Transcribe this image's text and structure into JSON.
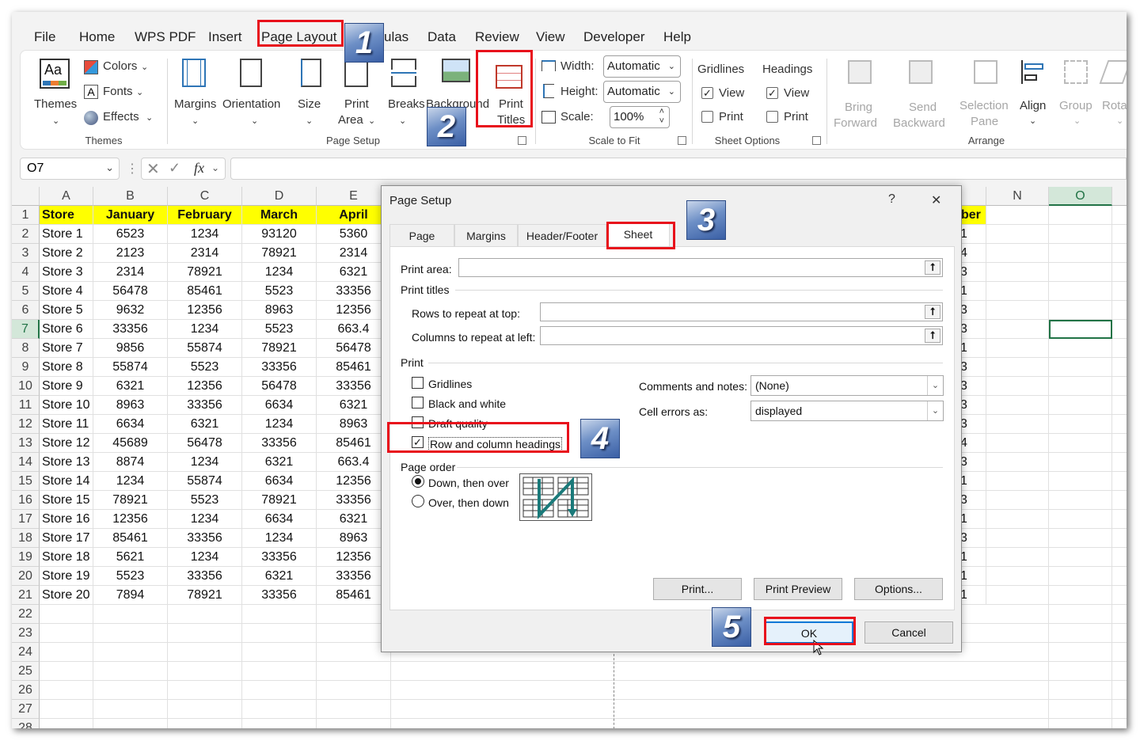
{
  "menu": [
    "File",
    "Home",
    "WPS PDF",
    "Insert",
    "Page Layout",
    "Formulas",
    "Data",
    "Review",
    "View",
    "Developer",
    "Help"
  ],
  "menu_visible": [
    "File",
    "Home",
    "WPS PDF",
    "Insert",
    "Page Layout",
    "ulas",
    "Data",
    "Review",
    "View",
    "Developer",
    "Help"
  ],
  "ribbon": {
    "themes": {
      "themes": "Themes",
      "colors": "Colors",
      "fonts": "Fonts",
      "effects": "Effects",
      "group": "Themes"
    },
    "page_setup": {
      "margins": "Margins",
      "orientation": "Orientation",
      "size": "Size",
      "print_area_1": "Print",
      "print_area_2": "Area",
      "breaks": "Breaks",
      "background": "Background",
      "print_titles_1": "Print",
      "print_titles_2": "Titles",
      "group": "Page Setup"
    },
    "scale": {
      "width_label": "Width:",
      "width_value": "Automatic",
      "height_label": "Height:",
      "height_value": "Automatic",
      "scale_label": "Scale:",
      "scale_value": "100%",
      "group": "Scale to Fit"
    },
    "sheet_options": {
      "gridlines": "Gridlines",
      "headings": "Headings",
      "view": "View",
      "print": "Print",
      "group": "Sheet Options"
    },
    "arrange": {
      "bring_1": "Bring",
      "bring_2": "Forward",
      "send_1": "Send",
      "send_2": "Backward",
      "selection_1": "Selection",
      "selection_2": "Pane",
      "align": "Align",
      "group_btn": "Group",
      "rotate": "Rota",
      "group": "Arrange"
    }
  },
  "formula_bar": {
    "name_box": "O7",
    "fx": "fx"
  },
  "columns": [
    "A",
    "B",
    "C",
    "D",
    "E",
    "N",
    "O"
  ],
  "rows": [
    1,
    2,
    3,
    4,
    5,
    6,
    7,
    8,
    9,
    10,
    11,
    12,
    13,
    14,
    15,
    16,
    17,
    18,
    19,
    20,
    21,
    22,
    23,
    24,
    25,
    26,
    27,
    28
  ],
  "table": {
    "headers": [
      "Store",
      "January",
      "February",
      "March",
      "April"
    ],
    "data": [
      [
        "Store 1",
        "6523",
        "1234",
        "93120",
        "5360"
      ],
      [
        "Store 2",
        "2123",
        "2314",
        "78921",
        "2314"
      ],
      [
        "Store 3",
        "2314",
        "78921",
        "1234",
        "6321"
      ],
      [
        "Store 4",
        "56478",
        "85461",
        "5523",
        "33356"
      ],
      [
        "Store 5",
        "9632",
        "12356",
        "8963",
        "12356"
      ],
      [
        "Store 6",
        "33356",
        "1234",
        "5523",
        "663.4"
      ],
      [
        "Store 7",
        "9856",
        "55874",
        "78921",
        "56478"
      ],
      [
        "Store 8",
        "55874",
        "5523",
        "33356",
        "85461"
      ],
      [
        "Store 9",
        "6321",
        "12356",
        "56478",
        "33356"
      ],
      [
        "Store 10",
        "8963",
        "33356",
        "6634",
        "6321"
      ],
      [
        "Store 11",
        "6634",
        "6321",
        "1234",
        "8963"
      ],
      [
        "Store 12",
        "45689",
        "56478",
        "33356",
        "85461"
      ],
      [
        "Store 13",
        "8874",
        "1234",
        "6321",
        "663.4"
      ],
      [
        "Store 14",
        "1234",
        "55874",
        "6634",
        "12356"
      ],
      [
        "Store 15",
        "78921",
        "5523",
        "78921",
        "33356"
      ],
      [
        "Store 16",
        "12356",
        "1234",
        "6634",
        "6321"
      ],
      [
        "Store 17",
        "85461",
        "33356",
        "1234",
        "8963"
      ],
      [
        "Store 18",
        "5621",
        "1234",
        "33356",
        "12356"
      ],
      [
        "Store 19",
        "5523",
        "33356",
        "6321",
        "33356"
      ],
      [
        "Store 20",
        "7894",
        "78921",
        "33356",
        "85461"
      ]
    ],
    "partial_header": "ber",
    "partial_col": [
      "1",
      "4",
      "3",
      "1",
      "3",
      "3",
      "1",
      "3",
      "3",
      "3",
      "3",
      "4",
      "3",
      "1",
      "3",
      "1",
      "3",
      "1",
      "1",
      "1"
    ]
  },
  "dialog": {
    "title": "Page Setup",
    "help": "?",
    "close": "✕",
    "tabs": [
      "Page",
      "Margins",
      "Header/Footer",
      "Sheet"
    ],
    "print_area": "Print area:",
    "print_titles": "Print titles",
    "rows_repeat": "Rows to repeat at top:",
    "cols_repeat": "Columns to repeat at left:",
    "print_section": "Print",
    "gridlines": "Gridlines",
    "black_white": "Black and white",
    "draft": "Draft quality",
    "row_col_headings": "Row and column headings",
    "comments_label": "Comments and notes:",
    "comments_value": "(None)",
    "errors_label": "Cell errors as:",
    "errors_value": "displayed",
    "page_order": "Page order",
    "down_over": "Down, then over",
    "over_down": "Over, then down",
    "print_btn": "Print...",
    "preview_btn": "Print Preview",
    "options_btn": "Options...",
    "ok_btn": "OK",
    "cancel_btn": "Cancel"
  },
  "badges": [
    "1",
    "2",
    "3",
    "4",
    "5"
  ],
  "colors": {
    "accent_red": "#e8101b",
    "header_yellow": "#ffff00",
    "selection_green": "#217346"
  }
}
